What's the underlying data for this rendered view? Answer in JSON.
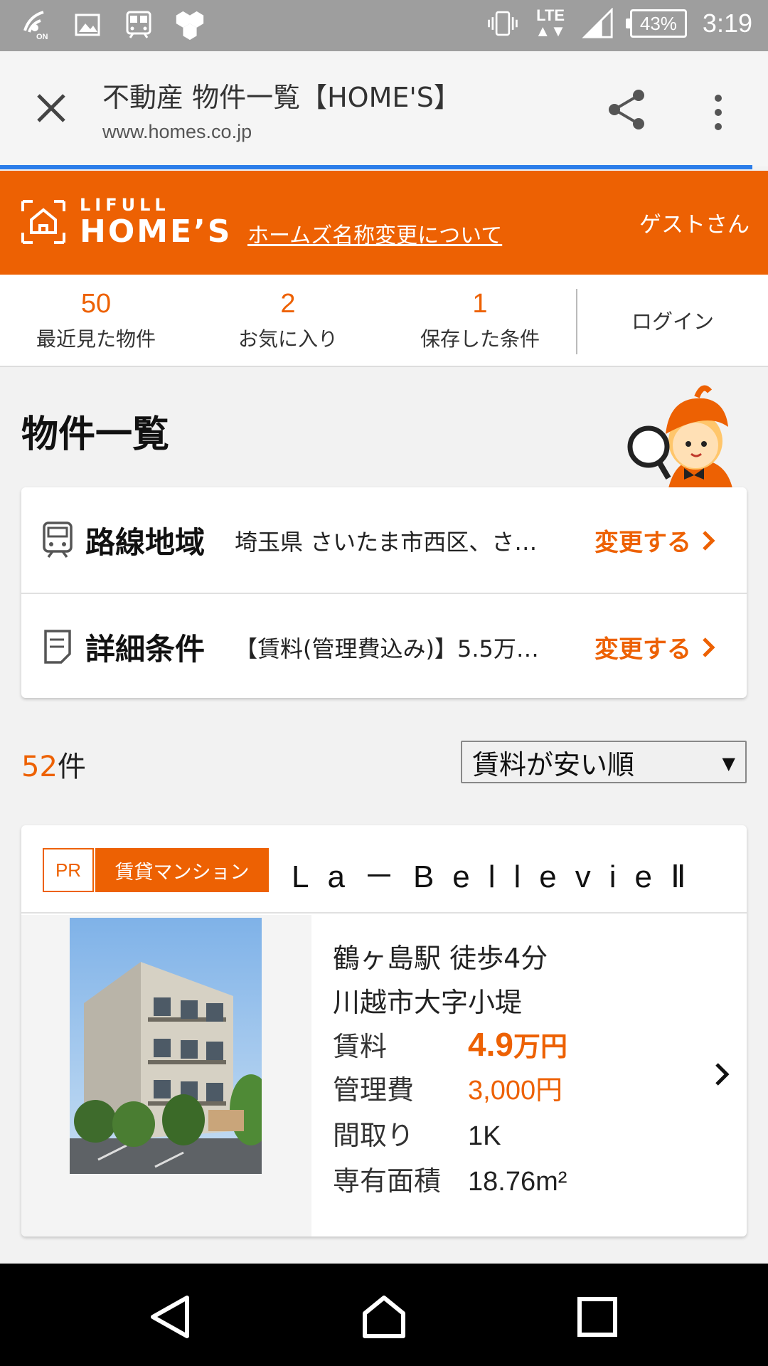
{
  "status_bar": {
    "time": "3:19",
    "network": "LTE",
    "battery": "43%",
    "icons": [
      "wifi-calling-icon",
      "image-icon",
      "train-icon",
      "hexagon-app-icon",
      "vibrate-icon",
      "signal-icon",
      "battery-icon"
    ]
  },
  "browser": {
    "page_title": "不動産 物件一覧【HOME'S】",
    "url": "www.homes.co.jp"
  },
  "header": {
    "logo_line1": "LIFULL",
    "logo_line2": "HOME’S",
    "rename_link": "ホームズ名称変更について",
    "guest": "ゲストさん"
  },
  "counts": [
    {
      "num": "50",
      "label": "最近見た物件"
    },
    {
      "num": "2",
      "label": "お気に入り"
    },
    {
      "num": "1",
      "label": "保存した条件"
    }
  ],
  "login": "ログイン",
  "page_title": "物件一覧",
  "conditions": [
    {
      "label": "路線地域",
      "value": "埼玉県 さいたま市西区、さ…",
      "action": "変更する"
    },
    {
      "label": "詳細条件",
      "value": "【賃料(管理費込み)】5.5万…",
      "action": "変更する"
    }
  ],
  "results": {
    "count": "52",
    "suffix": "件",
    "sort": "賃料が安い順"
  },
  "listing": {
    "pr": "PR",
    "type": "賃貸マンション",
    "name": "La－BellevieⅡ",
    "access": "鶴ヶ島駅 徒歩4分",
    "address": "川越市大字小堤",
    "rent_label": "賃料",
    "rent_value": "4.9",
    "rent_unit": "万円",
    "mgmt_label": "管理費",
    "mgmt_value": "3,000円",
    "layout_label": "間取り",
    "layout_value": "1K",
    "area_label": "専有面積",
    "area_value": "18.76m²"
  },
  "colors": {
    "brand": "#ed6103",
    "statusbar": "#9e9e9e",
    "progress": "#2b7de9"
  }
}
